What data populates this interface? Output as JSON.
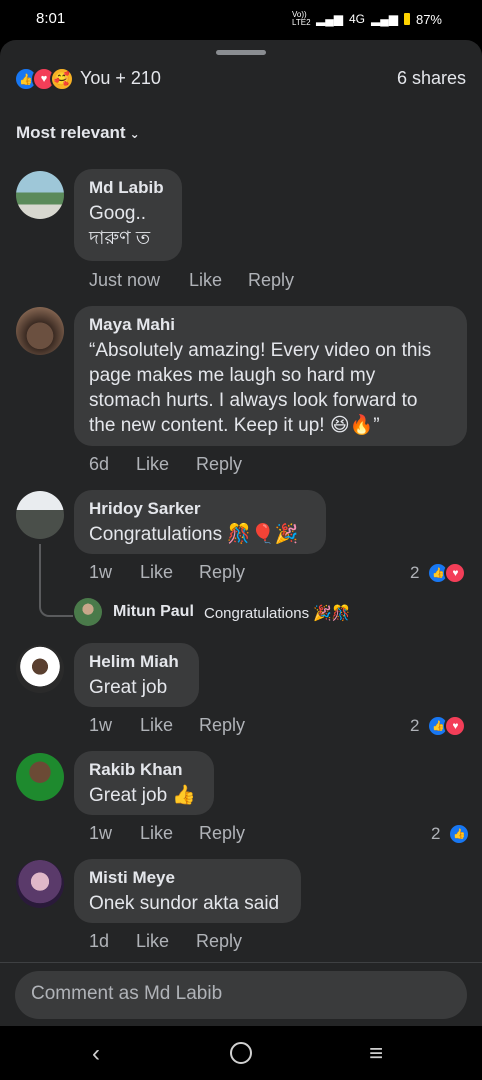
{
  "status_bar": {
    "time": "8:01",
    "carrier": "Vo)) LTE2",
    "network": "4G",
    "battery": "87%"
  },
  "header": {
    "reactions_summary": "You + 210",
    "shares": "6 shares",
    "reaction_icons": [
      "like-icon",
      "love-icon",
      "care-icon"
    ]
  },
  "sort": {
    "label": "Most relevant"
  },
  "comments": [
    {
      "name": "Md Labib",
      "lines": [
        "Goog..",
        "দারুণ ত"
      ],
      "time": "Just now",
      "like": "Like",
      "reply": "Reply"
    },
    {
      "name": "Maya Mahi",
      "lines": [
        "“Absolutely amazing! Every video on this",
        "page makes me laugh so hard my",
        "stomach hurts. I always look forward to",
        "the new content. Keep it up! 😆🔥”"
      ],
      "time": "6d",
      "like": "Like",
      "reply": "Reply"
    },
    {
      "name": "Hridoy Sarker",
      "lines": [
        "Congratulations 🎊🎈🎉"
      ],
      "time": "1w",
      "like": "Like",
      "reply": "Reply",
      "reaction_count": "2",
      "reply_preview": {
        "name": "Mitun Paul",
        "text": "Congratulations 🎉🎊"
      }
    },
    {
      "name": "Helim Miah",
      "lines": [
        "Great job"
      ],
      "time": "1w",
      "like": "Like",
      "reply": "Reply",
      "reaction_count": "2"
    },
    {
      "name": "Rakib Khan",
      "lines": [
        "Great job 👍"
      ],
      "time": "1w",
      "like": "Like",
      "reply": "Reply",
      "reaction_count": "2"
    },
    {
      "name": "Misti Meye",
      "lines": [
        "Onek sundor akta said"
      ],
      "time": "1d",
      "like": "Like",
      "reply": "Reply"
    }
  ],
  "composer": {
    "placeholder": "Comment as Md Labib"
  },
  "colors": {
    "like_blue": "#1877f2",
    "love_red": "#f33e58",
    "sheet_bg": "#242526",
    "bubble_bg": "#3a3b3c"
  }
}
